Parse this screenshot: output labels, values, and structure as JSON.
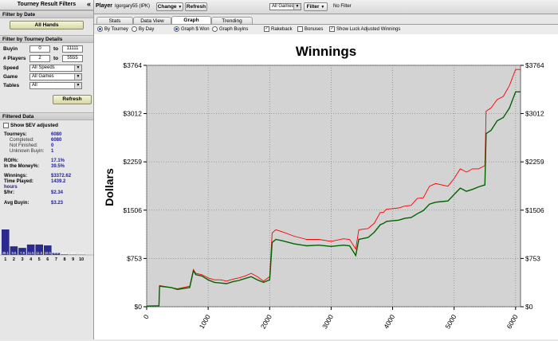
{
  "left_panel": {
    "title": "Tourney Result Filters",
    "collapse_glyph": "«",
    "filter_by_date": {
      "header": "Filter by Date",
      "button": "All Hands"
    },
    "filter_by_details": {
      "header": "Filter by Tourney Details",
      "buyin": {
        "label": "Buyin",
        "from": "0",
        "to_label": "to",
        "to": "11111"
      },
      "players": {
        "label": "# Players",
        "from": "2",
        "to_label": "to",
        "to": "5555"
      },
      "speed": {
        "label": "Speed",
        "value": "All Speeds"
      },
      "game": {
        "label": "Game",
        "value": "All Games"
      },
      "tables": {
        "label": "Tables",
        "value": "All"
      },
      "refresh": "Refresh"
    },
    "filtered_data": {
      "header": "Filtered Data",
      "show_ev": "Show $EV adjusted",
      "tourneys_label": "Tourneys:",
      "tourneys": "6080",
      "completed_label": "Completed:",
      "completed": "6080",
      "not_finished_label": "Not Finished:",
      "not_finished": "0",
      "unknown_label": "Unknown Buyin:",
      "unknown": "1",
      "roi_label": "ROI%:",
      "roi": "17.1%",
      "itm_label": "In the Money%:",
      "itm": "39.5%",
      "winnings_label": "Winnings:",
      "winnings": "$3372.62",
      "time_label": "Time Played:",
      "time": "1439.2",
      "time_unit": "hours",
      "hourly_label": "$/hr:",
      "hourly": "$2.34",
      "avg_buyin_label": "Avg Buyin:",
      "avg_buyin": "$3.23"
    },
    "histogram": {
      "bars": [
        {
          "label": "1",
          "value": 28.1,
          "text": "28.1"
        },
        {
          "label": "2",
          "value": 9.5,
          "text": "9.5"
        },
        {
          "label": "3",
          "value": 7.8,
          "text": "7.8"
        },
        {
          "label": "4",
          "value": 11.5,
          "text": "11.5"
        },
        {
          "label": "5",
          "value": 11.5,
          "text": "11.5"
        },
        {
          "label": "6",
          "value": 10.5,
          "text": "10.5"
        },
        {
          "label": "7",
          "value": 2.1,
          "text": "2.1"
        },
        {
          "label": "8",
          "value": 0.6,
          "text": "0.6"
        },
        {
          "label": "9",
          "value": 0.4,
          "text": "0.4"
        },
        {
          "label": "10",
          "value": 0.3,
          "text": "0.3"
        }
      ],
      "color": "#2b2b8e"
    }
  },
  "topbar": {
    "player_label": "Player",
    "player_name": "Igorgary55 (IPK)",
    "change": "Change",
    "refresh": "Refresh",
    "games_select": "All Games",
    "filter": "Filter",
    "filter_status": "No Filter"
  },
  "tabs": [
    {
      "label": "Stats",
      "active": false
    },
    {
      "label": "Data View",
      "active": false
    },
    {
      "label": "Graph",
      "active": true
    },
    {
      "label": "Trending",
      "active": false
    }
  ],
  "options": {
    "by_tourney": "By Tourney",
    "by_day": "By Day",
    "graph_won": "Graph $ Won",
    "graph_buyins": "Graph Buyins",
    "rakeback": "Rakeback",
    "bonuses": "Bonuses",
    "luck": "Show Luck Adjusted Winnings"
  },
  "colors": {
    "actual": "#ff0000",
    "luck_adjusted": "#006400",
    "plot_bg": "#d3d3d3"
  },
  "chart_data": {
    "type": "line",
    "title": "Winnings",
    "ylabel": "Dollars",
    "xlabel": "",
    "x_ticks": [
      0,
      1000,
      2000,
      3000,
      4000,
      5000,
      6000
    ],
    "y_ticks": [
      "$0",
      "$753",
      "$1506",
      "$2259",
      "$3012",
      "$3764"
    ],
    "y_tick_values": [
      0,
      753,
      1506,
      2259,
      3012,
      3764
    ],
    "xlim": [
      0,
      6080
    ],
    "ylim": [
      0,
      3764
    ],
    "grid": true,
    "series": [
      {
        "color": "#ff0000",
        "x": [
          0,
          200,
          210,
          400,
          500,
          700,
          760,
          800,
          900,
          1000,
          1100,
          1200,
          1300,
          1400,
          1500,
          1600,
          1700,
          1800,
          1900,
          2000,
          2040,
          2100,
          2200,
          2400,
          2600,
          2800,
          3000,
          3200,
          3300,
          3400,
          3450,
          3600,
          3700,
          3800,
          3850,
          3900,
          4000,
          4100,
          4200,
          4300,
          4400,
          4500,
          4600,
          4700,
          4800,
          4900,
          5000,
          5100,
          5200,
          5300,
          5400,
          5500,
          5520,
          5600,
          5700,
          5800,
          5900,
          6000,
          6080
        ],
        "y": [
          10,
          15,
          330,
          300,
          280,
          320,
          580,
          520,
          500,
          450,
          420,
          420,
          400,
          430,
          450,
          480,
          520,
          470,
          400,
          470,
          1150,
          1200,
          1170,
          1100,
          1050,
          1050,
          1020,
          1060,
          1050,
          900,
          1200,
          1220,
          1300,
          1470,
          1470,
          1520,
          1530,
          1540,
          1570,
          1580,
          1690,
          1700,
          1880,
          1920,
          1900,
          1880,
          2000,
          2150,
          2100,
          2150,
          2150,
          2200,
          3050,
          3100,
          3230,
          3280,
          3450,
          3700,
          3700
        ]
      },
      {
        "color": "#006400",
        "x": [
          0,
          200,
          210,
          400,
          500,
          700,
          760,
          800,
          900,
          1000,
          1100,
          1200,
          1300,
          1400,
          1500,
          1600,
          1700,
          1800,
          1900,
          2000,
          2040,
          2100,
          2200,
          2400,
          2600,
          2800,
          3000,
          3200,
          3300,
          3400,
          3450,
          3600,
          3700,
          3800,
          3850,
          3900,
          4000,
          4100,
          4200,
          4300,
          4400,
          4500,
          4600,
          4700,
          4800,
          4900,
          5000,
          5100,
          5200,
          5300,
          5400,
          5500,
          5520,
          5600,
          5700,
          5800,
          5900,
          6000,
          6080
        ],
        "y": [
          10,
          15,
          320,
          300,
          270,
          300,
          560,
          500,
          480,
          420,
          380,
          370,
          360,
          390,
          410,
          440,
          470,
          420,
          380,
          420,
          1000,
          1050,
          1030,
          980,
          950,
          960,
          940,
          960,
          950,
          800,
          1050,
          1080,
          1160,
          1280,
          1300,
          1330,
          1340,
          1350,
          1380,
          1390,
          1450,
          1500,
          1600,
          1630,
          1640,
          1650,
          1750,
          1850,
          1800,
          1830,
          1870,
          1900,
          2700,
          2750,
          2900,
          2950,
          3100,
          3350,
          3350
        ]
      }
    ]
  }
}
